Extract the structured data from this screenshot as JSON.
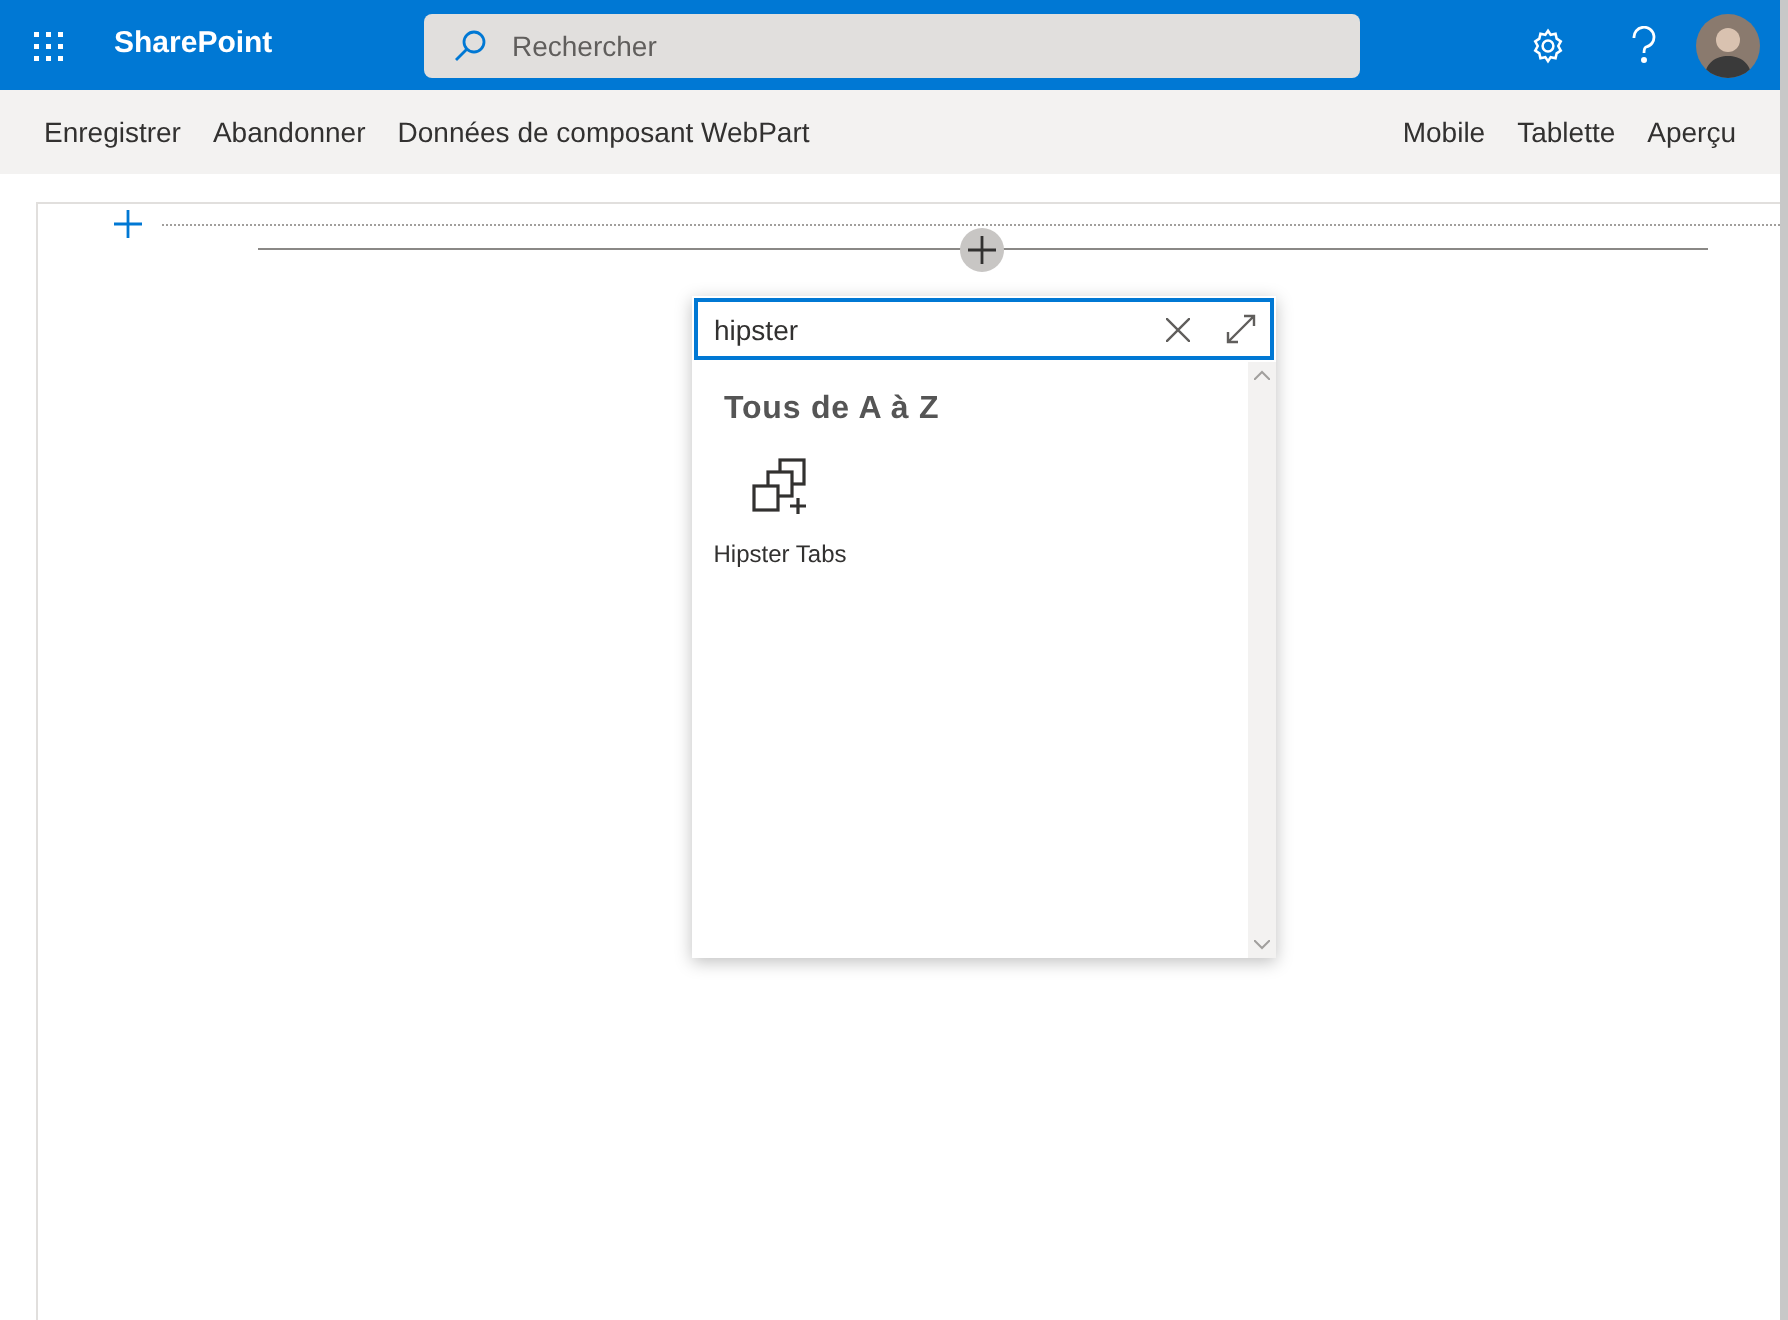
{
  "header": {
    "app_name": "SharePoint",
    "search": {
      "placeholder": "Rechercher"
    }
  },
  "toolbar": {
    "left": [
      "Enregistrer",
      "Abandonner",
      "Données de composant WebPart"
    ],
    "right": [
      "Mobile",
      "Tablette",
      "Aperçu"
    ]
  },
  "picker": {
    "search_value": "hipster",
    "section_title": "Tous de A à Z",
    "items": [
      {
        "label": "Hipster Tabs"
      }
    ]
  }
}
